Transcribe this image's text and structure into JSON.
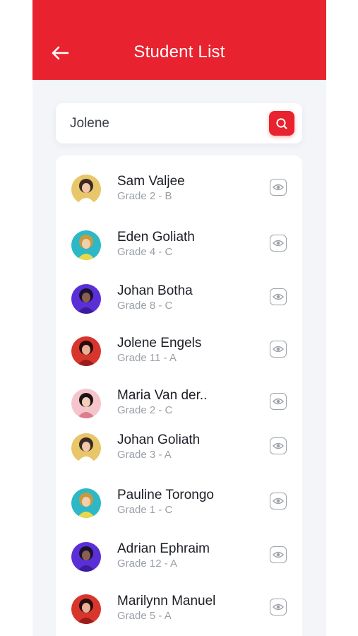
{
  "header": {
    "title": "Student List",
    "background_color": "#e8222e",
    "back_icon": "arrow-left-icon"
  },
  "search": {
    "value": "Jolene",
    "placeholder": "Search",
    "button_icon": "search-icon",
    "accent_color": "#e8222e"
  },
  "students": [
    {
      "name": "Sam Valjee",
      "grade": "Grade 2 - B",
      "avatar": "yellow"
    },
    {
      "name": "Eden Goliath",
      "grade": "Grade 4 - C",
      "avatar": "teal"
    },
    {
      "name": "Johan Botha",
      "grade": "Grade 8 - C",
      "avatar": "purple"
    },
    {
      "name": "Jolene Engels",
      "grade": "Grade 11 - A",
      "avatar": "red"
    },
    {
      "name": "Maria Van der..",
      "grade": "Grade 2 - C",
      "avatar": "pink"
    },
    {
      "name": "Johan Goliath",
      "grade": "Grade 3 - A",
      "avatar": "yellow"
    },
    {
      "name": "Pauline Torongo",
      "grade": "Grade 1 - C",
      "avatar": "teal"
    },
    {
      "name": "Adrian Ephraim",
      "grade": "Grade 12 - A",
      "avatar": "purple"
    },
    {
      "name": "Marilynn Manuel",
      "grade": "Grade 5 - A",
      "avatar": "red"
    }
  ],
  "row_action_icon": "eye-icon"
}
